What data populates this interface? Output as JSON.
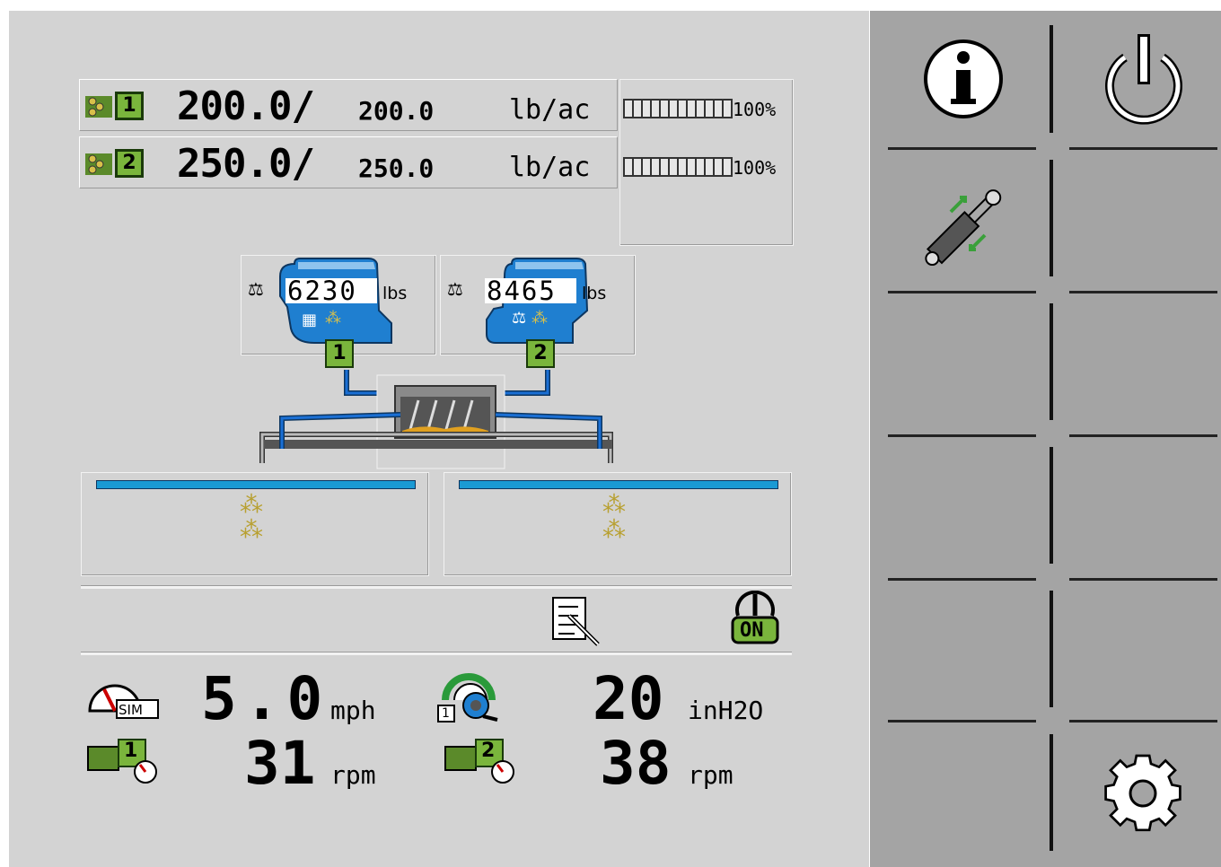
{
  "rates": [
    {
      "channel": "1",
      "actual": "200.0/",
      "target": "200.0",
      "unit": "lb/ac",
      "fill_percent": 100,
      "percent_label": "100%"
    },
    {
      "channel": "2",
      "actual": "250.0/",
      "target": "250.0",
      "unit": "lb/ac",
      "fill_percent": 100,
      "percent_label": "100%"
    }
  ],
  "hoppers": [
    {
      "number": "1",
      "weight": "6230",
      "unit": "lbs"
    },
    {
      "number": "2",
      "weight": "8465",
      "unit": "lbs"
    }
  ],
  "stats": {
    "speed_value": "5.0",
    "speed_unit": "mph",
    "speed_badge": "SIM",
    "pressure_value": "20",
    "pressure_unit": "inH2O",
    "pressure_badge": "1",
    "motor1_value": "31",
    "motor1_unit": "rpm",
    "motor1_badge": "1",
    "motor2_value": "38",
    "motor2_unit": "rpm",
    "motor2_badge": "2"
  },
  "toolbar": {
    "on_label": "ON"
  },
  "icons": {
    "info": "info-icon",
    "power": "power-icon",
    "hydraulic": "hydraulic-cylinder-icon",
    "settings": "gear-icon",
    "task": "task-list-icon",
    "master": "master-switch-on-icon"
  },
  "colors": {
    "hopper_blue": "#1f7fd0",
    "badge_green": "#7ab53c",
    "hose_blue": "#1a6fd4"
  }
}
